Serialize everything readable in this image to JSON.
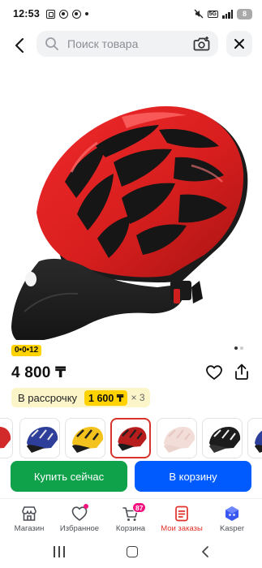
{
  "status_bar": {
    "time": "12:53",
    "network": "5G",
    "battery": "8"
  },
  "header": {
    "search_placeholder": "Поиск товара"
  },
  "product": {
    "timer_badge": "0•0•12",
    "price": "4 800 ₸",
    "installment": {
      "label": "В рассрочку",
      "amount": "1 600 ₸",
      "times": "× 3"
    },
    "image_dots": {
      "count": 2,
      "active_index": 0
    },
    "variant_thumbnails": [
      {
        "color": "#d22a2a",
        "partial": true
      },
      {
        "color": "#2d3f9a",
        "accent": "#e8e8e8"
      },
      {
        "color": "#f4c21c",
        "accent": "#1f1f1f"
      },
      {
        "color": "#b81d1d",
        "accent": "#1f1f1f",
        "selected": true
      },
      {
        "color": "#f2ddd8",
        "accent": "#f7e9e5"
      },
      {
        "color": "#1c1c1c",
        "accent": "#f0f0f0"
      },
      {
        "color": "#2d3f9a",
        "partial": true
      }
    ]
  },
  "actions": {
    "buy_now": "Купить сейчас",
    "add_to_cart": "В корзину"
  },
  "bottom_nav": {
    "items": [
      {
        "label": "Магазин",
        "icon": "store-icon"
      },
      {
        "label": "Избранное",
        "icon": "heart-icon",
        "has_dot": true
      },
      {
        "label": "Корзина",
        "icon": "cart-icon",
        "badge": "87"
      },
      {
        "label": "Мои заказы",
        "icon": "orders-icon",
        "active": true
      },
      {
        "label": "Kasper",
        "icon": "kasper-icon"
      }
    ]
  },
  "colors": {
    "buy_now": "#10a14b",
    "add_to_cart": "#005bff",
    "badge_yellow": "#ffd200",
    "active_nav": "#e0322a",
    "cart_badge": "#f1117e"
  }
}
